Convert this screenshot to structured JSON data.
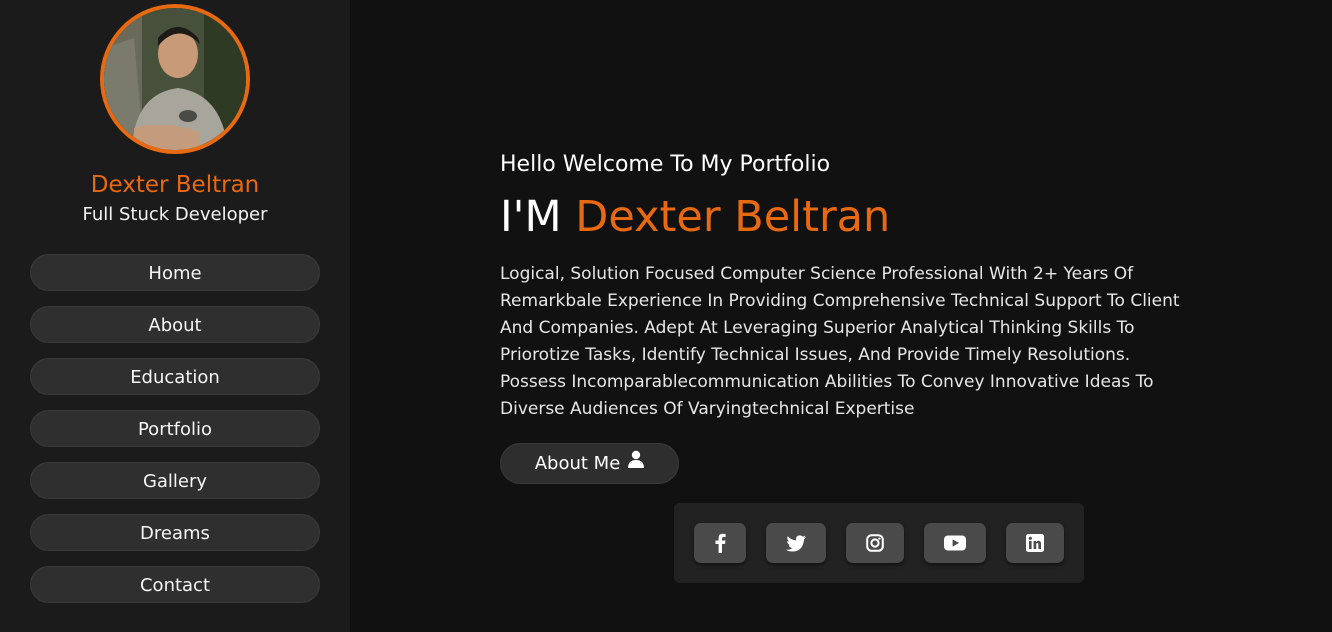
{
  "sidebar": {
    "name": "Dexter Beltran",
    "role": "Full Stuck Developer",
    "nav": [
      {
        "label": "Home"
      },
      {
        "label": "About"
      },
      {
        "label": "Education"
      },
      {
        "label": "Portfolio"
      },
      {
        "label": "Gallery"
      },
      {
        "label": "Dreams"
      },
      {
        "label": "Contact"
      }
    ]
  },
  "hero": {
    "greeting": "Hello Welcome To My Portfolio",
    "intro_prefix": "I'M",
    "intro_name": "Dexter Beltran",
    "bio": "Logical, Solution Focused Computer Science Professional With 2+ Years Of Remarkbale Experience In Providing Comprehensive Technical Support To Client And Companies. Adept At Leveraging Superior Analytical Thinking Skills To Priorotize Tasks, Identify Technical Issues, And Provide Timely Resolutions. Possess Incomparablecommunication Abilities To Convey Innovative Ideas To Diverse Audiences Of Varyingtechnical Expertise",
    "about_button": "About Me",
    "about_icon": "user-icon"
  },
  "social": [
    {
      "icon": "facebook-icon"
    },
    {
      "icon": "twitter-icon"
    },
    {
      "icon": "instagram-icon"
    },
    {
      "icon": "youtube-icon"
    },
    {
      "icon": "linkedin-icon"
    }
  ],
  "colors": {
    "accent": "#e8690f",
    "background": "#111111",
    "sidebar": "#1b1b1b",
    "button": "#2f2f2f"
  }
}
